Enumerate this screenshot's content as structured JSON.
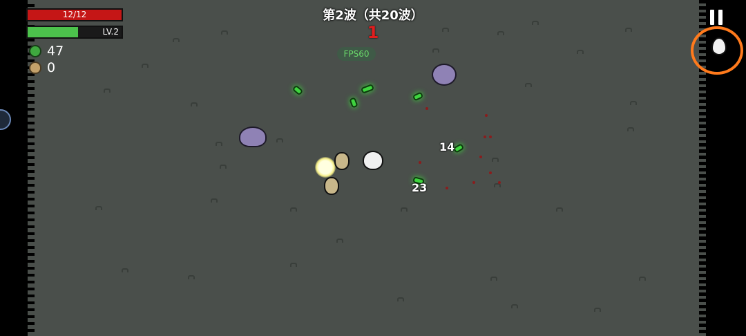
{
  "hud": {
    "hp_text": "12/12",
    "hp_fraction": 1.0,
    "level_text": "LV.2",
    "xp_fraction": 0.54,
    "materials_count": "47",
    "bag_count": "0"
  },
  "wave": {
    "title": "第2波（共20波）",
    "timer": "1"
  },
  "debug": {
    "fps_label": "FPS60"
  },
  "combat": {
    "damage_numbers": [
      "14",
      "23"
    ]
  },
  "icons": {
    "materials": "green-material-icon",
    "bag": "loot-bag-icon",
    "pause": "pause-icon",
    "character": "egg-character-icon"
  },
  "colors": {
    "hp": "#c51616",
    "xp": "#4cc24c",
    "timer": "#e01e1e",
    "annotation": "#ff7a1c"
  }
}
